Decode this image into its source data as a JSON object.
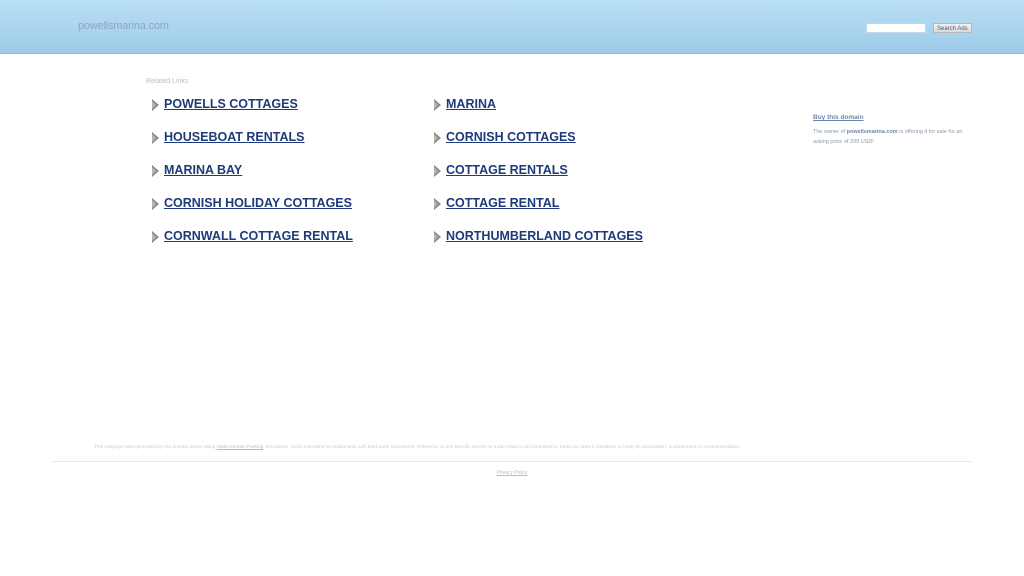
{
  "header": {
    "domain": "powellsmarina.com",
    "search_button_label": "Search Ads",
    "search_value": ""
  },
  "related": {
    "heading": "Related Links",
    "left_column": [
      "POWELLS COTTAGES",
      "HOUSEBOAT RENTALS",
      "MARINA BAY",
      "CORNISH HOLIDAY COTTAGES",
      "CORNWALL COTTAGE RENTAL"
    ],
    "right_column": [
      "MARINA",
      "CORNISH COTTAGES",
      "COTTAGE RENTALS",
      "COTTAGE RENTAL",
      "NORTHUMBERLAND COTTAGES"
    ]
  },
  "sidebar": {
    "buy_label": "Buy this domain",
    "sale_prefix": "The owner of ",
    "sale_domain": "powellsmarina.com",
    "sale_suffix": " is offering it for sale for an asking price of 299 USD!"
  },
  "footer": {
    "disclaimer_prefix": "This webpage was generated by the domain owner using ",
    "disclaimer_link": "Sedo Domain Parking",
    "disclaimer_suffix": ". Disclaimer: Sedo maintains no relationship with third party advertisers. Reference to any specific service or trade mark is not controlled by Sedo nor does it constitute or imply its association, endorsement or recommendation.",
    "privacy_label": "Privacy Policy"
  },
  "colors": {
    "header_bg": "#a9d4ee",
    "link": "#1d3a7a",
    "arrow": "#8a8a8a"
  },
  "icons": {
    "link_bullet": "arrow-right-icon"
  }
}
